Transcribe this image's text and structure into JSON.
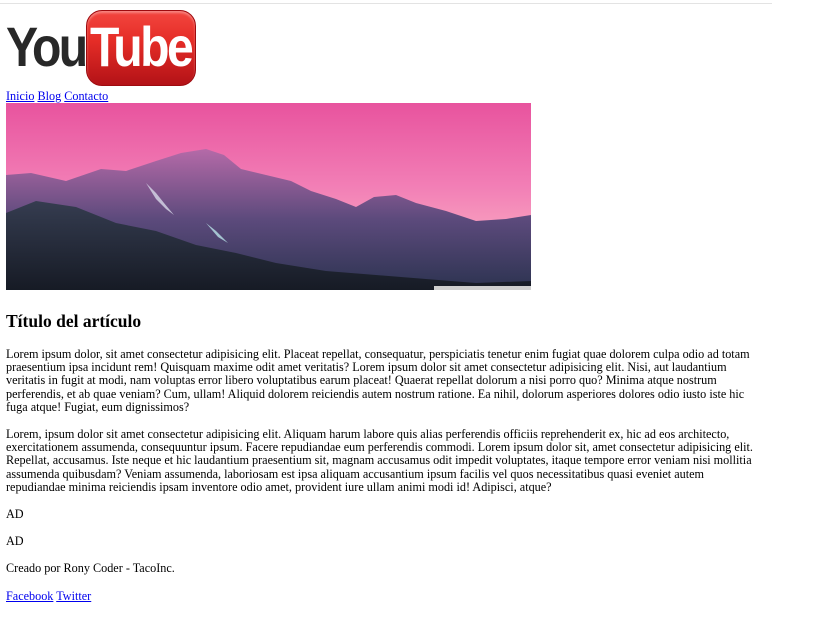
{
  "logo": {
    "part1": "You",
    "part2": "Tube"
  },
  "nav": [
    {
      "label": "Inicio"
    },
    {
      "label": "Blog"
    },
    {
      "label": "Contacto"
    }
  ],
  "article": {
    "title": "Título del artículo",
    "paragraphs": [
      "Lorem ipsum dolor, sit amet consectetur adipisicing elit. Placeat repellat, consequatur, perspiciatis tenetur enim fugiat quae dolorem culpa odio ad totam praesentium ipsa incidunt rem! Quisquam maxime odit amet veritatis? Lorem ipsum dolor sit amet consectetur adipisicing elit. Nisi, aut laudantium veritatis in fugit at modi, nam voluptas error libero voluptatibus earum placeat! Quaerat repellat dolorum a nisi porro quo? Minima atque nostrum perferendis, et ab quae veniam? Cum, ullam! Aliquid dolorem reiciendis autem nostrum ratione. Ea nihil, dolorum asperiores dolores odio iusto iste hic fuga atque! Fugiat, eum dignissimos?",
      "Lorem, ipsum dolor sit amet consectetur adipisicing elit. Aliquam harum labore quis alias perferendis officiis reprehenderit ex, hic ad eos architecto, exercitationem assumenda, consequuntur ipsum. Facere repudiandae eum perferendis commodi. Lorem ipsum dolor sit, amet consectetur adipisicing elit. Repellat, accusamus. Iste neque et hic laudantium praesentium sit, magnam accusamus odit impedit voluptates, itaque tempore error veniam nisi mollitia assumenda quibusdam? Veniam assumenda, laboriosam est ipsa aliquam accusantium ipsum facilis vel quos necessitatibus quasi eveniet autem repudiandae minima reiciendis ipsam inventore odio amet, provident iure ullam animi modi id! Adipisci, atque?"
    ]
  },
  "ads": [
    "AD",
    "AD"
  ],
  "footer": {
    "credit": "Creado por Rony Coder - TacoInc.",
    "social": [
      {
        "label": "Facebook"
      },
      {
        "label": "Twitter"
      }
    ]
  }
}
